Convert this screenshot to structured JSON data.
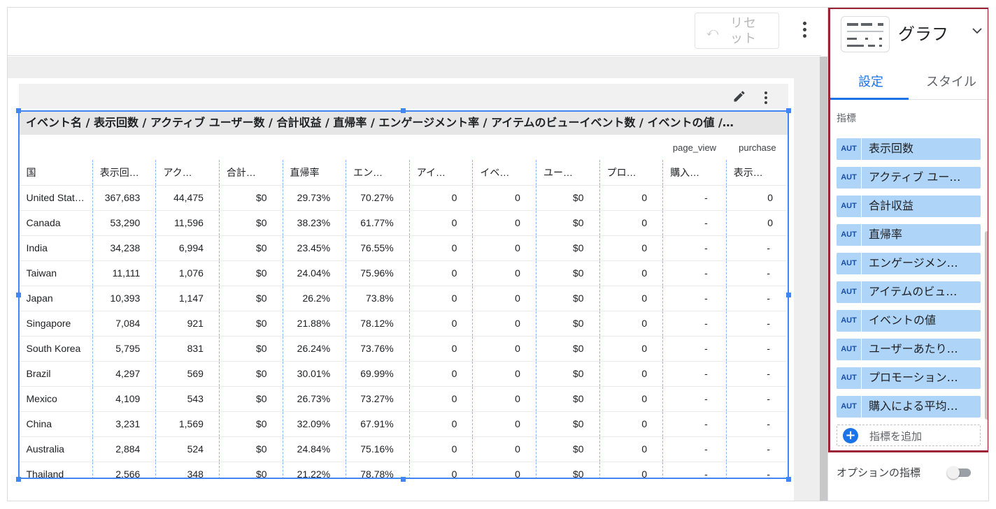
{
  "toolbar": {
    "reset_label": "リセット",
    "reset_icon": "undo-icon",
    "more_icon": "more-vert-icon"
  },
  "table": {
    "title": "イベント名 / 表示回数 / アクティブ ユーザー数 / 合計収益 / 直帰率 / エンゲージメント率 / アイテムのビューイベント数 / イベントの値 /…",
    "subheaders": [
      "",
      "",
      "",
      "",
      "",
      "",
      "",
      "",
      "",
      "",
      "page_view",
      "purchase"
    ],
    "columns": [
      "国",
      "表示回…",
      "アク…",
      "合計…",
      "直帰率",
      "エン…",
      "アイ…",
      "イベ…",
      "ユー…",
      "プロ…",
      "購入…",
      "表示…"
    ],
    "rows": [
      [
        "United Stat…",
        "367,683",
        "44,475",
        "$0",
        "29.73%",
        "70.27%",
        "0",
        "0",
        "$0",
        "0",
        "-",
        "0"
      ],
      [
        "Canada",
        "53,290",
        "11,596",
        "$0",
        "38.23%",
        "61.77%",
        "0",
        "0",
        "$0",
        "0",
        "-",
        "0"
      ],
      [
        "India",
        "34,238",
        "6,994",
        "$0",
        "23.45%",
        "76.55%",
        "0",
        "0",
        "$0",
        "0",
        "-",
        "-"
      ],
      [
        "Taiwan",
        "11,111",
        "1,076",
        "$0",
        "24.04%",
        "75.96%",
        "0",
        "0",
        "$0",
        "0",
        "-",
        "-"
      ],
      [
        "Japan",
        "10,393",
        "1,147",
        "$0",
        "26.2%",
        "73.8%",
        "0",
        "0",
        "$0",
        "0",
        "-",
        "-"
      ],
      [
        "Singapore",
        "7,084",
        "921",
        "$0",
        "21.88%",
        "78.12%",
        "0",
        "0",
        "$0",
        "0",
        "-",
        "-"
      ],
      [
        "South Korea",
        "5,795",
        "831",
        "$0",
        "26.24%",
        "73.76%",
        "0",
        "0",
        "$0",
        "0",
        "-",
        "-"
      ],
      [
        "Brazil",
        "4,297",
        "569",
        "$0",
        "30.01%",
        "69.99%",
        "0",
        "0",
        "$0",
        "0",
        "-",
        "-"
      ],
      [
        "Mexico",
        "4,109",
        "543",
        "$0",
        "26.73%",
        "73.27%",
        "0",
        "0",
        "$0",
        "0",
        "-",
        "-"
      ],
      [
        "China",
        "3,231",
        "1,569",
        "$0",
        "32.09%",
        "67.91%",
        "0",
        "0",
        "$0",
        "0",
        "-",
        "-"
      ],
      [
        "Australia",
        "2,884",
        "524",
        "$0",
        "24.84%",
        "75.16%",
        "0",
        "0",
        "$0",
        "0",
        "-",
        "-"
      ],
      [
        "Thailand",
        "2,566",
        "348",
        "$0",
        "21.22%",
        "78.78%",
        "0",
        "0",
        "$0",
        "0",
        "-",
        "-"
      ]
    ]
  },
  "panel": {
    "chart_type": "グラフ",
    "tabs": [
      "設定",
      "スタイル"
    ],
    "active_tab": "設定",
    "metrics_title": "指標",
    "aut_label": "AUT",
    "metrics": [
      "表示回数",
      "アクティブ ユー…",
      "合計収益",
      "直帰率",
      "エンゲージメン…",
      "アイテムのビュ…",
      "イベントの値",
      "ユーザーあたり…",
      "プロモーション…",
      "購入による平均…"
    ],
    "add_metric": "指標を追加",
    "optional_metrics": "オプションの指標",
    "highlight_color": "#9b2335",
    "accent_color": "#1a73e8"
  }
}
